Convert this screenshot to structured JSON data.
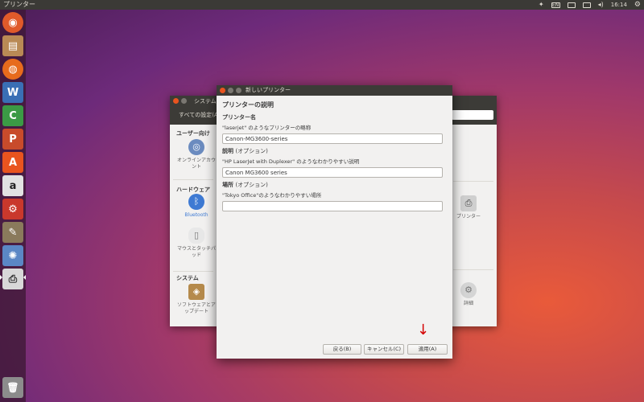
{
  "topbar": {
    "app_name": "プリンター",
    "lang_indicator": "EN",
    "clock": "16:14"
  },
  "launcher": {
    "items": [
      {
        "name": "dash-icon",
        "color": "#e05a2a",
        "glyph": "◉"
      },
      {
        "name": "files-icon",
        "color": "#b98a55",
        "glyph": "▤"
      },
      {
        "name": "firefox-icon",
        "color": "#e76b1c",
        "glyph": "◍"
      },
      {
        "name": "writer-icon",
        "color": "#3a6fb5",
        "glyph": "W"
      },
      {
        "name": "calc-icon",
        "color": "#3b9a45",
        "glyph": "C"
      },
      {
        "name": "impress-icon",
        "color": "#c84b2b",
        "glyph": "P"
      },
      {
        "name": "software-center-icon",
        "color": "#e9541f",
        "glyph": "A"
      },
      {
        "name": "amazon-icon",
        "color": "#e2e2e2",
        "glyph": "a"
      },
      {
        "name": "system-settings-icon",
        "color": "#c9382c",
        "glyph": "⚙"
      },
      {
        "name": "gimp-icon",
        "color": "#8a7a5c",
        "glyph": "✎"
      },
      {
        "name": "swirl-app-icon",
        "color": "#5b87c5",
        "glyph": "✺"
      },
      {
        "name": "printer-app-icon",
        "color": "#d8d8d8",
        "glyph": "⎙"
      }
    ],
    "trash": {
      "name": "trash-icon",
      "glyph": "🗑"
    }
  },
  "settings_window": {
    "title": "システム設定",
    "all_settings": "すべての設定(A)",
    "sections": {
      "personal": "ユーザー向け",
      "hardware": "ハードウェア",
      "system": "システム"
    },
    "items": {
      "online_accounts": "オンラインアカウント",
      "bluetooth": "Bluetooth",
      "mouse_touchpad": "マウスとタッチパッド",
      "software_updates": "ソフトウェアとアップデート",
      "printers": "プリンター",
      "details": "詳細"
    }
  },
  "dialog": {
    "title": "新しいプリンター",
    "heading": "プリンターの説明",
    "printer_name": {
      "label": "プリンター名",
      "hint": "\"laserjet\" のようなプリンターの略称",
      "value": "Canon-MG3600-series"
    },
    "description": {
      "label": "説明",
      "optional": "(オプション)",
      "hint": "\"HP LaserJet with Duplexer\" のようなわかりやすい説明",
      "value": "Canon MG3600 series"
    },
    "location": {
      "label": "場所",
      "optional": "(オプション)",
      "hint": "\"Tokyo Office\"のようなわかりやすい場所",
      "value": ""
    },
    "buttons": {
      "back": "戻る(B)",
      "cancel": "キャンセル(C)",
      "apply": "適用(A)"
    }
  },
  "annotation": {
    "arrow": "↓",
    "color": "#d40000"
  }
}
